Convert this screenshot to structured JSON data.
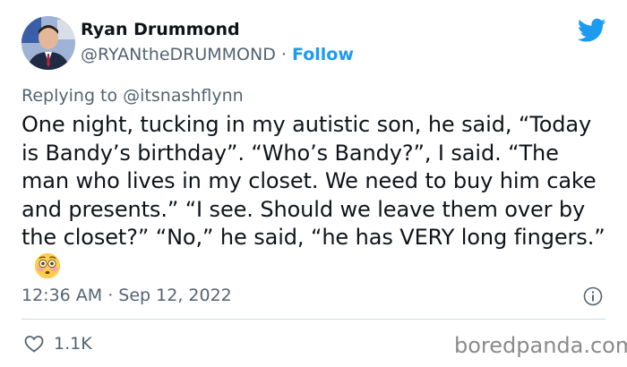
{
  "author": {
    "name": "Ryan Drummond",
    "handle": "@RYANtheDRUMMOND",
    "separator": "·",
    "follow_label": "Follow"
  },
  "reply": {
    "prefix": "Replying to ",
    "handle": "@itsnashflynn"
  },
  "tweet": {
    "text": "One night, tucking in my autistic son, he said, “Today is Bandy’s birthday”. “Who’s Bandy?”, I said. “The man who lives in my closet. We need to buy him cake and presents.” “I see. Should we leave them over by the closet?” “No,” he said, “he has VERY long fingers.”",
    "emoji": "flushed-face-emoji",
    "timestamp": "12:36 AM · Sep 12, 2022"
  },
  "actions": {
    "like_count": "1.1K"
  },
  "watermark": "boredpanda.com",
  "icons": {
    "brand": "twitter-bird-icon",
    "info": "info-icon",
    "like": "heart-icon"
  },
  "colors": {
    "accent": "#1d9bf0",
    "text": "#0f1419",
    "muted": "#536471",
    "divider": "#cfd9de"
  }
}
